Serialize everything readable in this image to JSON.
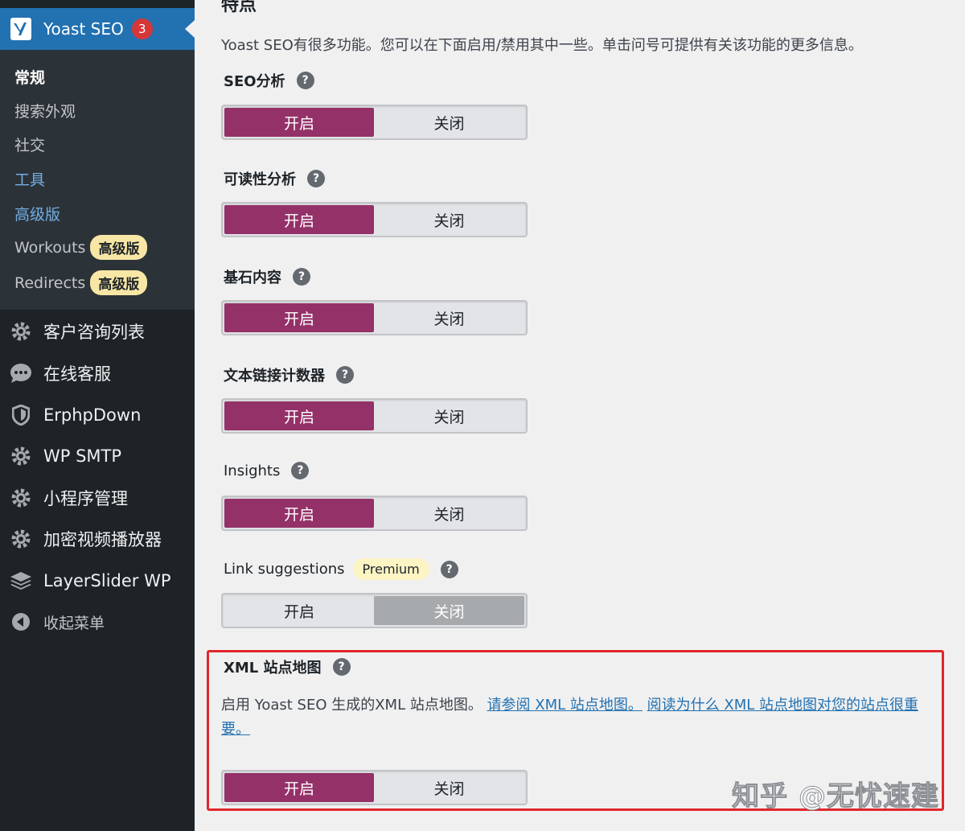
{
  "sidebar": {
    "plugin": {
      "title": "Yoast SEO",
      "count": "3"
    },
    "submenu": [
      {
        "label": "常规",
        "state": "current"
      },
      {
        "label": "搜索外观",
        "state": "normal"
      },
      {
        "label": "社交",
        "state": "normal"
      },
      {
        "label": "工具",
        "state": "link"
      },
      {
        "label": "高级版",
        "state": "link"
      },
      {
        "label": "Workouts",
        "badge": "高级版"
      },
      {
        "label": "Redirects",
        "badge": "高级版"
      }
    ],
    "menu": [
      {
        "label": "客户咨询列表",
        "icon": "gear-icon"
      },
      {
        "label": "在线客服",
        "icon": "chat-icon"
      },
      {
        "label": "ErphpDown",
        "icon": "shield-icon"
      },
      {
        "label": "WP SMTP",
        "icon": "gear-icon"
      },
      {
        "label": "小程序管理",
        "icon": "gear-icon"
      },
      {
        "label": "加密视频播放器",
        "icon": "gear-icon"
      },
      {
        "label": "LayerSlider WP",
        "icon": "layers-icon"
      },
      {
        "label": "收起菜单",
        "icon": "collapse-icon"
      }
    ]
  },
  "content": {
    "heading": "特点",
    "intro": "Yoast SEO有很多功能。您可以在下面启用/禁用其中一些。单击问号可提供有关该功能的更多信息。",
    "help_symbol": "?",
    "toggle_on": "开启",
    "toggle_off": "关闭",
    "features": [
      {
        "label": "SEO分析",
        "state": "on"
      },
      {
        "label": "可读性分析",
        "state": "on"
      },
      {
        "label": "基石内容",
        "state": "on"
      },
      {
        "label": "文本链接计数器",
        "state": "on"
      },
      {
        "label": "Insights",
        "state": "on"
      },
      {
        "label": "Link suggestions",
        "badge": "Premium",
        "state": "off"
      },
      {
        "label": "XML 站点地图",
        "state": "on"
      }
    ],
    "xml_description": {
      "text": "启用 Yoast SEO 生成的XML 站点地图。",
      "link1": "请参阅 XML 站点地图。",
      "link2": "阅读为什么 XML 站点地图对您的站点很重要。"
    },
    "highlight_color": "#e0262b"
  },
  "watermark": "知乎 @无忧速建",
  "colors": {
    "accent": "#943168",
    "sidebar": "#1d2327",
    "active_menu": "#2271b1"
  }
}
